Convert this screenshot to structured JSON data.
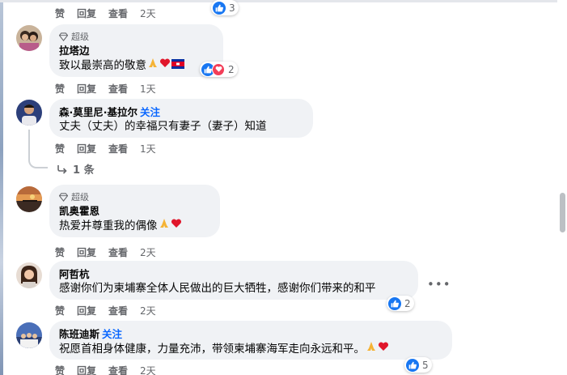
{
  "actions": {
    "like": "赞",
    "reply": "回复",
    "view": "查看"
  },
  "top_partial": {
    "time": "2天",
    "reaction_count": "3"
  },
  "comments": [
    {
      "badge": "超级",
      "author": "拉塔边",
      "text": "致以最崇高的敬意",
      "time": "1天",
      "reaction_count": "2"
    },
    {
      "author": "森·莫里尼·基拉尔",
      "follow": "关注",
      "text": "丈夫（丈夫）的幸福只有妻子（妻子）知道",
      "time": "1天"
    },
    {
      "badge": "超级",
      "author": "凯奥霍恩",
      "text": "热爱并尊重我的偶像",
      "time": "2天"
    },
    {
      "author": "阿哲杭",
      "text": "感谢你们为柬埔寨全体人民做出的巨大牺牲，感谢你们带来的和平",
      "time": "2天",
      "reaction_count": "2"
    },
    {
      "author": "陈班迪斯",
      "follow": "关注",
      "text": "祝愿首相身体健康，力量充沛，带领柬埔寨海军走向永远和平。",
      "time": "2天",
      "reaction_count": "5"
    }
  ],
  "replies_label": "1 条",
  "colors": {
    "like_blue": "#1877f2",
    "love_red": "#f33e58",
    "bubble_bg": "#f0f2f5",
    "link_blue": "#0866ff"
  }
}
